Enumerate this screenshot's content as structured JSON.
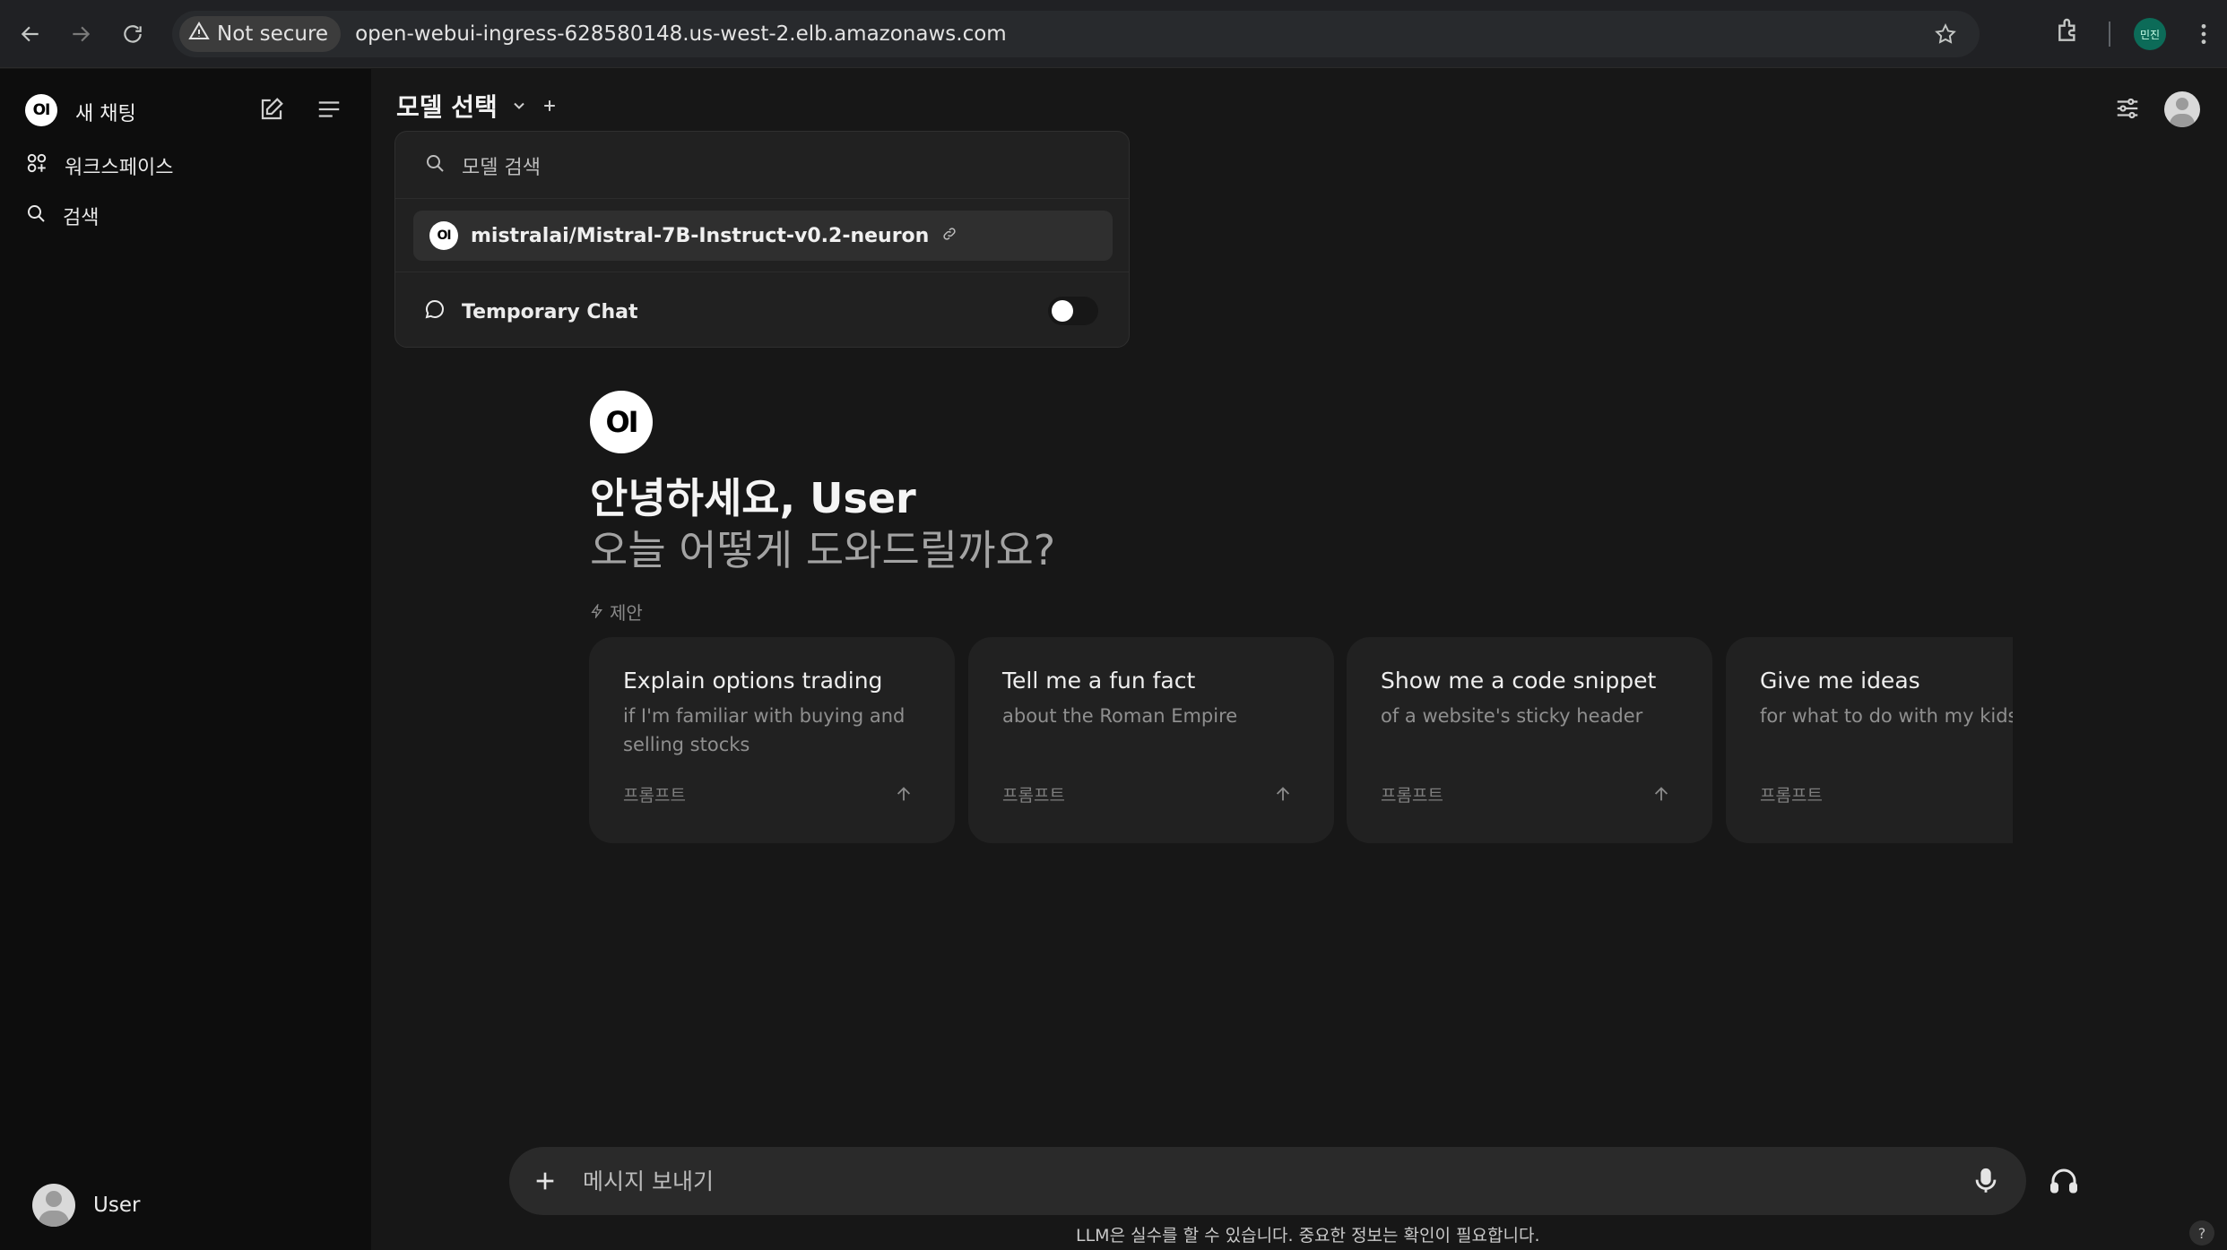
{
  "browser": {
    "security_label": "Not secure",
    "url": "open-webui-ingress-628580148.us-west-2.elb.amazonaws.com",
    "profile_initials": "민진"
  },
  "sidebar": {
    "logo_text": "OI",
    "title": "새 채팅",
    "items": [
      {
        "label": "워크스페이스",
        "icon": "workspace-icon"
      },
      {
        "label": "검색",
        "icon": "search-icon"
      }
    ],
    "user_name": "User"
  },
  "header": {
    "model_select_label": "모델 선택"
  },
  "dropdown": {
    "search_placeholder": "모델 검색",
    "model_logo_text": "OI",
    "model_name": "mistralai/Mistral-7B-Instruct-v0.2-neuron",
    "temporary_chat_label": "Temporary Chat",
    "temporary_chat_enabled": false
  },
  "greeting": {
    "logo_text": "OI",
    "title": "안녕하세요, User",
    "subtitle": "오늘 어떻게 도와드릴까요?",
    "suggestions_label": "제안"
  },
  "cards": [
    {
      "title": "Explain options trading",
      "desc": "if I'm familiar with buying and selling stocks",
      "tag": "프롬프트"
    },
    {
      "title": "Tell me a fun fact",
      "desc": "about the Roman Empire",
      "tag": "프롬프트"
    },
    {
      "title": "Show me a code snippet",
      "desc": "of a website's sticky header",
      "tag": "프롬프트"
    },
    {
      "title": "Give me ideas",
      "desc": "for what to do with my kids' art",
      "tag": "프롬프트"
    }
  ],
  "composer": {
    "placeholder": "메시지 보내기"
  },
  "footer": {
    "disclaimer": "LLM은 실수를 할 수 있습니다. 중요한 정보는 확인이 필요합니다.",
    "help_label": "?"
  },
  "colors": {
    "background": "#171717",
    "sidebar": "#0d0d0d",
    "card": "#212121",
    "accent": "#ffffff"
  }
}
